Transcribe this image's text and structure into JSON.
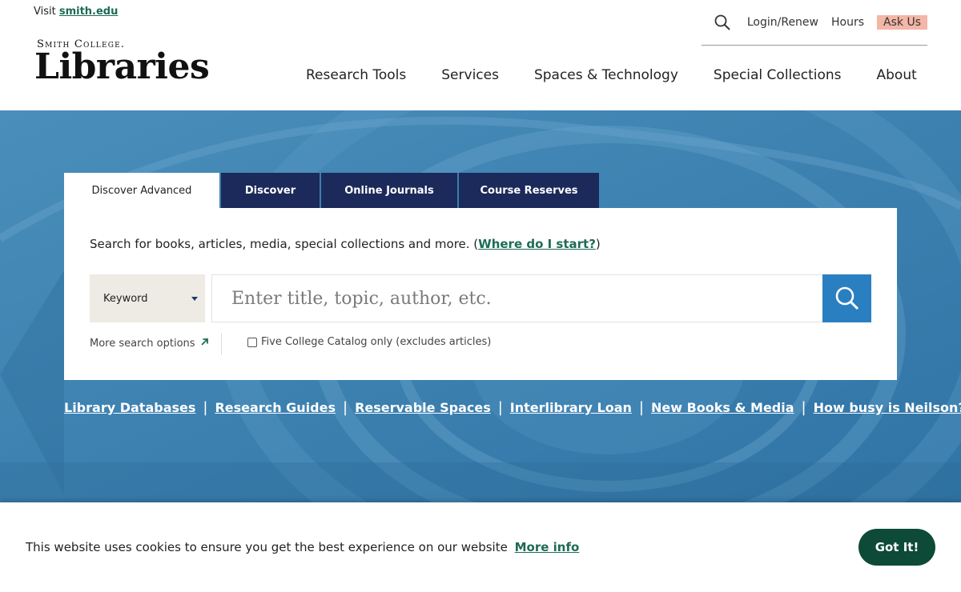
{
  "header": {
    "visit_prefix": "Visit",
    "visit_link": "smith.edu",
    "logo_top": "Smith College.",
    "logo_main": "Libraries",
    "utility": {
      "login": "Login/Renew",
      "hours": "Hours",
      "ask": "Ask Us"
    },
    "nav": [
      "Research Tools",
      "Services",
      "Spaces & Technology",
      "Special Collections",
      "About"
    ]
  },
  "search": {
    "tabs": [
      "Discover Advanced",
      "Discover",
      "Online Journals",
      "Course Reserves"
    ],
    "active_tab": "Discover Advanced",
    "intro_text": "Search for books, articles, media, special collections and more. (",
    "intro_link": "Where do I start?",
    "intro_close": ")",
    "field_select": "Keyword",
    "input_placeholder": "Enter title, topic, author, etc.",
    "more_options": "More search options",
    "five_college_label": "Five College Catalog only (excludes articles)",
    "five_college_checked": false
  },
  "quick_links": [
    "Library Databases",
    "Research Guides",
    "Reservable Spaces",
    "Interlibrary Loan",
    "New Books & Media",
    "How busy is Neilson?"
  ],
  "cookie": {
    "text": "This website uses cookies to ensure you get the best experience on our website",
    "link": "More info",
    "button": "Got It!"
  },
  "colors": {
    "brand_green": "#1d6b55",
    "tab_navy": "#1b2a5a",
    "hero_blue": "#3a7fae",
    "search_button": "#2a7fc0",
    "ask_us_bg": "#f4b6a6",
    "cookie_button": "#0d4a37"
  }
}
